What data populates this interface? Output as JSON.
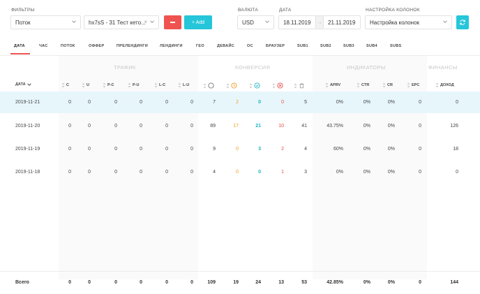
{
  "filters": {
    "label": "ФИЛЬТРЫ",
    "type_value": "Поток",
    "flow_value": "hx7sS - 31 Тест кето...",
    "add_label": "+ Add"
  },
  "currency": {
    "label": "ВАЛЮТА",
    "value": "USD"
  },
  "date": {
    "label": "ДАТА",
    "from": "18.11.2019",
    "to": "21.11.2019"
  },
  "columns": {
    "label": "НАСТРОЙКА КОЛОНОК",
    "value": "Настройка колонок"
  },
  "tabs": [
    "ДАТА",
    "ЧАС",
    "ПОТОК",
    "ОФФЕР",
    "ПРЕЛЕНДИНГИ",
    "ЛЕНДИНГИ",
    "ГЕО",
    "ДЕВАЙС",
    "ОС",
    "БРАУЗЕР",
    "SUB1",
    "SUB2",
    "SUB3",
    "SUB4",
    "SUBS"
  ],
  "groups": {
    "traffic": "ТРАФИК",
    "conversion": "КОНВЕРСИЯ",
    "indicators": "ИНДИКАТОРЫ",
    "finance": "ФИНАНСЫ"
  },
  "headers": {
    "date": "ДАТА",
    "c": "C",
    "u": "U",
    "pc": "P-C",
    "pu": "P-U",
    "lc": "L-C",
    "lu": "L-U",
    "aprv": "APRV",
    "ctr": "CTR",
    "cr": "CR",
    "epc": "EPC",
    "income": "ДОХОД"
  },
  "rows": [
    {
      "date": "2019-11-21",
      "c": "0",
      "u": "0",
      "pc": "0",
      "pu": "0",
      "lc": "0",
      "lu": "0",
      "total": "7",
      "hold": "2",
      "approved": "0",
      "rejected": "0",
      "trash": "5",
      "aprv": "0%",
      "ctr": "0%",
      "cr": "0%",
      "epc": "0",
      "income": "0"
    },
    {
      "date": "2019-11-20",
      "c": "0",
      "u": "0",
      "pc": "0",
      "pu": "0",
      "lc": "0",
      "lu": "0",
      "total": "89",
      "hold": "17",
      "approved": "21",
      "rejected": "10",
      "trash": "41",
      "aprv": "43.75%",
      "ctr": "0%",
      "cr": "0%",
      "epc": "0",
      "income": "126"
    },
    {
      "date": "2019-11-19",
      "c": "0",
      "u": "0",
      "pc": "0",
      "pu": "0",
      "lc": "0",
      "lu": "0",
      "total": "9",
      "hold": "0",
      "approved": "3",
      "rejected": "2",
      "trash": "4",
      "aprv": "60%",
      "ctr": "0%",
      "cr": "0%",
      "epc": "0",
      "income": "18"
    },
    {
      "date": "2019-11-18",
      "c": "0",
      "u": "0",
      "pc": "0",
      "pu": "0",
      "lc": "0",
      "lu": "0",
      "total": "4",
      "hold": "0",
      "approved": "0",
      "rejected": "1",
      "trash": "3",
      "aprv": "0%",
      "ctr": "0%",
      "cr": "0%",
      "epc": "0",
      "income": "0"
    }
  ],
  "totals": {
    "label": "Всего",
    "c": "0",
    "u": "0",
    "pc": "0",
    "pu": "0",
    "lc": "0",
    "lu": "0",
    "total": "109",
    "hold": "19",
    "approved": "24",
    "rejected": "13",
    "trash": "53",
    "aprv": "42.85%",
    "ctr": "0%",
    "cr": "0%",
    "epc": "0",
    "income": "144"
  },
  "colors": {
    "accent_red": "#ef5350",
    "accent_teal": "#26c6da",
    "hold_orange": "#f39c1f",
    "approved_teal": "#1fb4c9",
    "rejected_red": "#e84b48",
    "row_highlight": "#e7f6fb"
  }
}
